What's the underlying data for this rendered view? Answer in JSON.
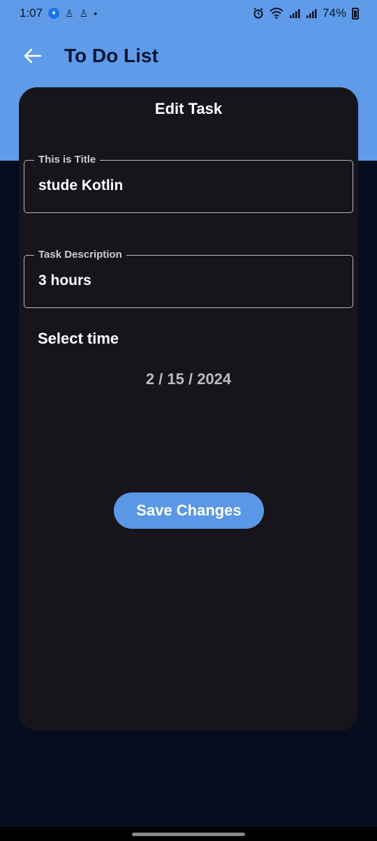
{
  "status_bar": {
    "time": "1:07",
    "battery": "74%",
    "icons": [
      "messenger-icon",
      "app-notification-icon",
      "app-notification-icon",
      "dot-icon",
      "alarm-icon",
      "wifi-icon",
      "signal-icon",
      "signal-icon",
      "battery-charging-icon"
    ]
  },
  "app_bar": {
    "title": "To Do List",
    "back_icon": "arrow-left-icon"
  },
  "card": {
    "title": "Edit Task",
    "title_field": {
      "label": "This is Title",
      "value": "stude Kotlin"
    },
    "description_field": {
      "label": "Task Description",
      "value": "3 hours"
    },
    "select_time_label": "Select time",
    "date": "2 / 15 / 2024",
    "save_button": "Save Changes"
  },
  "colors": {
    "header_blue": "#5f9be9",
    "background": "#060d1e",
    "card": "#17151b",
    "button": "#5a97e6"
  }
}
